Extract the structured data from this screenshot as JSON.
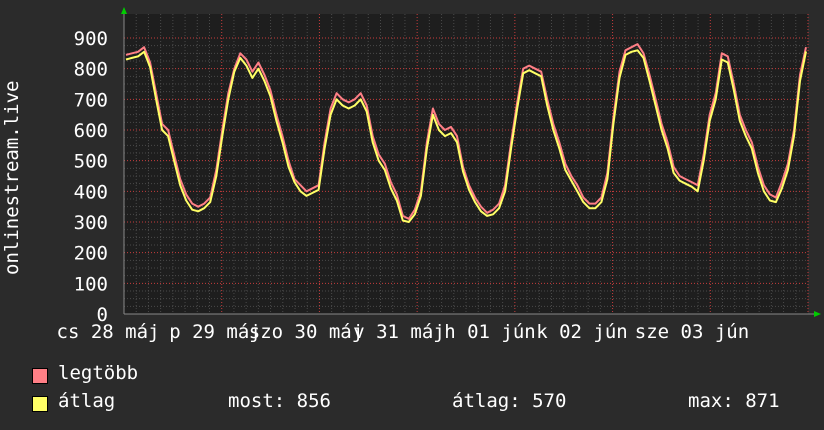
{
  "chart_data": {
    "type": "line",
    "ylabel": "onlinestream.live",
    "ylim": [
      0,
      900
    ],
    "y_ticks": [
      "0",
      "100",
      "200",
      "300",
      "400",
      "500",
      "600",
      "700",
      "800",
      "900"
    ],
    "x_tick_labels": [
      "cs 28 máj",
      "p 29 máj",
      "szo 30 máj",
      "v 31 máj",
      "h 01 jún",
      "k 02 jún",
      "sze 03 jún"
    ],
    "grid": true,
    "colors": {
      "max": "#ff7f86",
      "avg": "#ffff66",
      "background": "#2b2b2b",
      "plot_bg": "#1e1e1e",
      "grid": "#4a4a4a",
      "grid_minor": "#c83c3c",
      "arrow": "#00cc00"
    },
    "series": [
      {
        "name": "legtöbb",
        "values": [
          845,
          850,
          855,
          870,
          820,
          720,
          620,
          600,
          520,
          440,
          390,
          360,
          350,
          360,
          380,
          470,
          600,
          720,
          800,
          850,
          830,
          790,
          820,
          780,
          730,
          650,
          580,
          500,
          440,
          420,
          400,
          410,
          420,
          560,
          670,
          720,
          700,
          690,
          700,
          720,
          680,
          580,
          520,
          490,
          430,
          390,
          320,
          310,
          340,
          400,
          560,
          670,
          620,
          600,
          610,
          580,
          480,
          420,
          380,
          350,
          330,
          340,
          360,
          420,
          560,
          690,
          800,
          810,
          800,
          790,
          700,
          620,
          560,
          490,
          450,
          420,
          380,
          360,
          360,
          380,
          460,
          640,
          790,
          860,
          870,
          880,
          850,
          780,
          700,
          620,
          560,
          480,
          450,
          440,
          430,
          420,
          520,
          650,
          720,
          850,
          840,
          750,
          650,
          600,
          560,
          480,
          420,
          390,
          380,
          430,
          490,
          600,
          780,
          870
        ],
        "x_start": "cs 28 máj"
      },
      {
        "name": "átlag",
        "values": [
          830,
          835,
          840,
          855,
          805,
          700,
          600,
          580,
          500,
          420,
          370,
          340,
          335,
          345,
          365,
          450,
          580,
          700,
          790,
          835,
          810,
          770,
          800,
          760,
          710,
          630,
          560,
          480,
          430,
          400,
          385,
          395,
          405,
          540,
          650,
          700,
          680,
          670,
          680,
          700,
          660,
          560,
          500,
          470,
          410,
          370,
          305,
          300,
          325,
          385,
          540,
          650,
          600,
          580,
          590,
          560,
          465,
          405,
          365,
          335,
          320,
          325,
          345,
          400,
          540,
          670,
          785,
          795,
          785,
          775,
          680,
          600,
          540,
          470,
          435,
          400,
          365,
          345,
          345,
          365,
          440,
          620,
          770,
          845,
          855,
          860,
          835,
          760,
          680,
          600,
          540,
          460,
          435,
          425,
          415,
          400,
          500,
          630,
          700,
          830,
          820,
          730,
          630,
          580,
          540,
          460,
          400,
          370,
          365,
          410,
          470,
          580,
          760,
          856
        ]
      }
    ]
  },
  "legend": {
    "items": [
      {
        "label": "legtöbb",
        "color": "#ff7f86"
      },
      {
        "label": "átlag",
        "color": "#ffff66"
      }
    ]
  },
  "stats": {
    "now": "most: 856",
    "avg": "átlag: 570",
    "max": "max: 871"
  }
}
